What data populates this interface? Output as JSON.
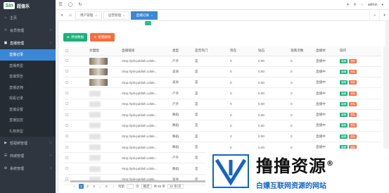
{
  "app": {
    "logo_mark": "Sin",
    "logo_text": "超值乐"
  },
  "sidebar": {
    "items": [
      {
        "icon": "⌂",
        "label": "主页"
      },
      {
        "icon": "☉",
        "label": "会员管理",
        "arrow": "›"
      },
      {
        "icon": "▣",
        "label": "直播管理",
        "arrow": "‹"
      }
    ],
    "subitems": [
      {
        "label": "直播记录",
        "active": true
      },
      {
        "label": "直播类型"
      },
      {
        "label": "直播预告"
      },
      {
        "label": "直播返佣"
      },
      {
        "label": "观看记录"
      },
      {
        "label": "直播设置"
      },
      {
        "label": "直播监控"
      },
      {
        "label": "礼物类型"
      }
    ],
    "bottom_items": [
      {
        "icon": "▶",
        "label": "短视频管理",
        "arrow": "›"
      },
      {
        "icon": "☰",
        "label": "商城管理",
        "arrow": "›"
      },
      {
        "icon": "⚙",
        "label": "系统管理",
        "arrow": "›"
      }
    ]
  },
  "topbar": {
    "admin": "admin"
  },
  "tabs": [
    {
      "label": "用户管理"
    },
    {
      "label": "运营管理"
    },
    {
      "label": "直播记录",
      "active": true
    }
  ],
  "toolbar": {
    "add_label": "添加数据",
    "del_label": "批量删除"
  },
  "table": {
    "headers": [
      "",
      "封面图",
      "直播链接",
      "类型",
      "是否热门",
      "现在",
      "钻石",
      "观看次数",
      "直播状",
      "操作"
    ],
    "rows": [
      {
        "thumb": "photo",
        "link": "rtmp://pili-publish.cdsle...",
        "type": "户外",
        "hot": "是",
        "now": "0",
        "diamond": "0.00",
        "views": "0",
        "status": "直播中"
      },
      {
        "thumb": "photo",
        "link": "rtmp://pili-publish.cdsle...",
        "type": "美食",
        "hot": "是",
        "now": "0",
        "diamond": "0.00",
        "views": "0",
        "status": "直播中"
      },
      {
        "thumb": "photo",
        "link": "rtmp://pili-publish.cdsle...",
        "type": "美食",
        "hot": "是",
        "now": "0",
        "diamond": "0.00",
        "views": "0",
        "status": "直播中"
      },
      {
        "thumb": "blur",
        "link": "rtmp://pili-publish.cdsle...",
        "type": "户外",
        "hot": "是",
        "now": "0",
        "diamond": "0.00",
        "views": "0",
        "status": "直播中"
      },
      {
        "thumb": "blur",
        "link": "rtmp://pili-publish.cdsle...",
        "type": "户外",
        "hot": "是",
        "now": "0",
        "diamond": "0.00",
        "views": "0",
        "status": "直播中"
      },
      {
        "thumb": "blur",
        "link": "rtmp://pili-publish.cdsle...",
        "type": "舞蹈",
        "hot": "是",
        "now": "0",
        "diamond": "0.00",
        "views": "0",
        "status": "直播中"
      },
      {
        "thumb": "blur",
        "link": "rtmp://pili-publish.cdsle...",
        "type": "舞蹈",
        "hot": "是",
        "now": "0",
        "diamond": "0.00",
        "views": "0",
        "status": "直播中"
      },
      {
        "thumb": "blur",
        "link": "rtmp://pili-publish.cdsle...",
        "type": "舞蹈",
        "hot": "是",
        "now": "0",
        "diamond": "0.00",
        "views": "0",
        "status": "直播中"
      },
      {
        "thumb": "blur",
        "link": "rtmp://pili-publish.cdsle...",
        "type": "舞蹈",
        "hot": "是",
        "now": "0",
        "diamond": "0.00",
        "views": "0",
        "status": "直播中"
      },
      {
        "thumb": "blur",
        "link": "rtmp://pili-publish.cdsle...",
        "type": "户外",
        "hot": "是",
        "now": "0",
        "diamond": "0.00",
        "views": "0",
        "status": "直播中"
      },
      {
        "thumb": "blur",
        "link": "rtmp://pili-publish.cdsle...",
        "type": "舞蹈",
        "hot": "是",
        "now": "0",
        "diamond": "0.00",
        "views": "0",
        "status": "直播中"
      },
      {
        "thumb": "blur",
        "link": "rtmp://pili-publish.cdsle...",
        "type": "美食",
        "hot": "是",
        "now": "0",
        "diamond": "0.00",
        "views": "0",
        "status": "直播中"
      }
    ],
    "edit_label": "编辑",
    "del_label": "删除"
  },
  "pager": {
    "prev": "‹",
    "pages": [
      "1",
      "2",
      "3",
      "...",
      "6"
    ],
    "next": "›",
    "goto_label": "到第",
    "page_unit": "页",
    "confirm": "确定",
    "total": "共 55 条",
    "per_page": "10 条/页"
  },
  "watermark": {
    "title": "撸撸资源",
    "reg": "®",
    "subtitle": "白嫖互联网资源的网站"
  },
  "colors": {
    "sidebar": "#2f3640",
    "accent": "#3b87d6",
    "green": "#18b37a",
    "orange": "#f56c3c"
  }
}
